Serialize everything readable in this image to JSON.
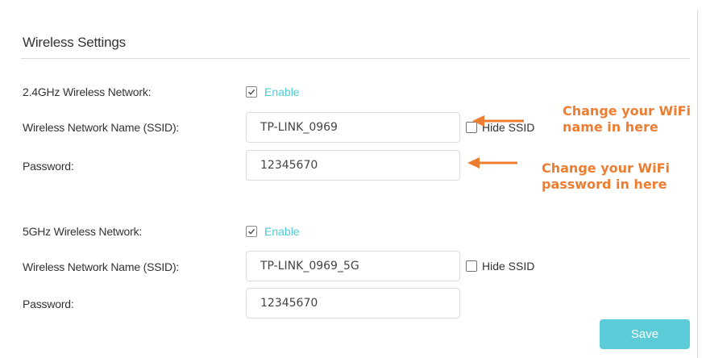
{
  "section": {
    "title": "Wireless Settings"
  },
  "band_24": {
    "network_label": "2.4GHz Wireless Network:",
    "enable_label": "Enable",
    "enabled": true,
    "ssid_label": "Wireless Network Name (SSID):",
    "ssid_value": "TP-LINK_0969",
    "hide_ssid_label": "Hide SSID",
    "hide_ssid_checked": false,
    "password_label": "Password:",
    "password_value": "12345670"
  },
  "band_5": {
    "network_label": "5GHz Wireless Network:",
    "enable_label": "Enable",
    "enabled": true,
    "ssid_label": "Wireless Network Name (SSID):",
    "ssid_value": "TP-LINK_0969_5G",
    "hide_ssid_label": "Hide SSID",
    "hide_ssid_checked": false,
    "password_label": "Password:",
    "password_value": "12345670"
  },
  "annotations": {
    "ssid_line1": "Change your WiFi",
    "ssid_line2": "name in here",
    "password_line1": "Change your WiFi",
    "password_line2": "password in here",
    "color": "#ED7D31"
  },
  "actions": {
    "save_label": "Save"
  },
  "colors": {
    "accent": "#5CCDD8",
    "enable_text": "#4ACBD6"
  }
}
